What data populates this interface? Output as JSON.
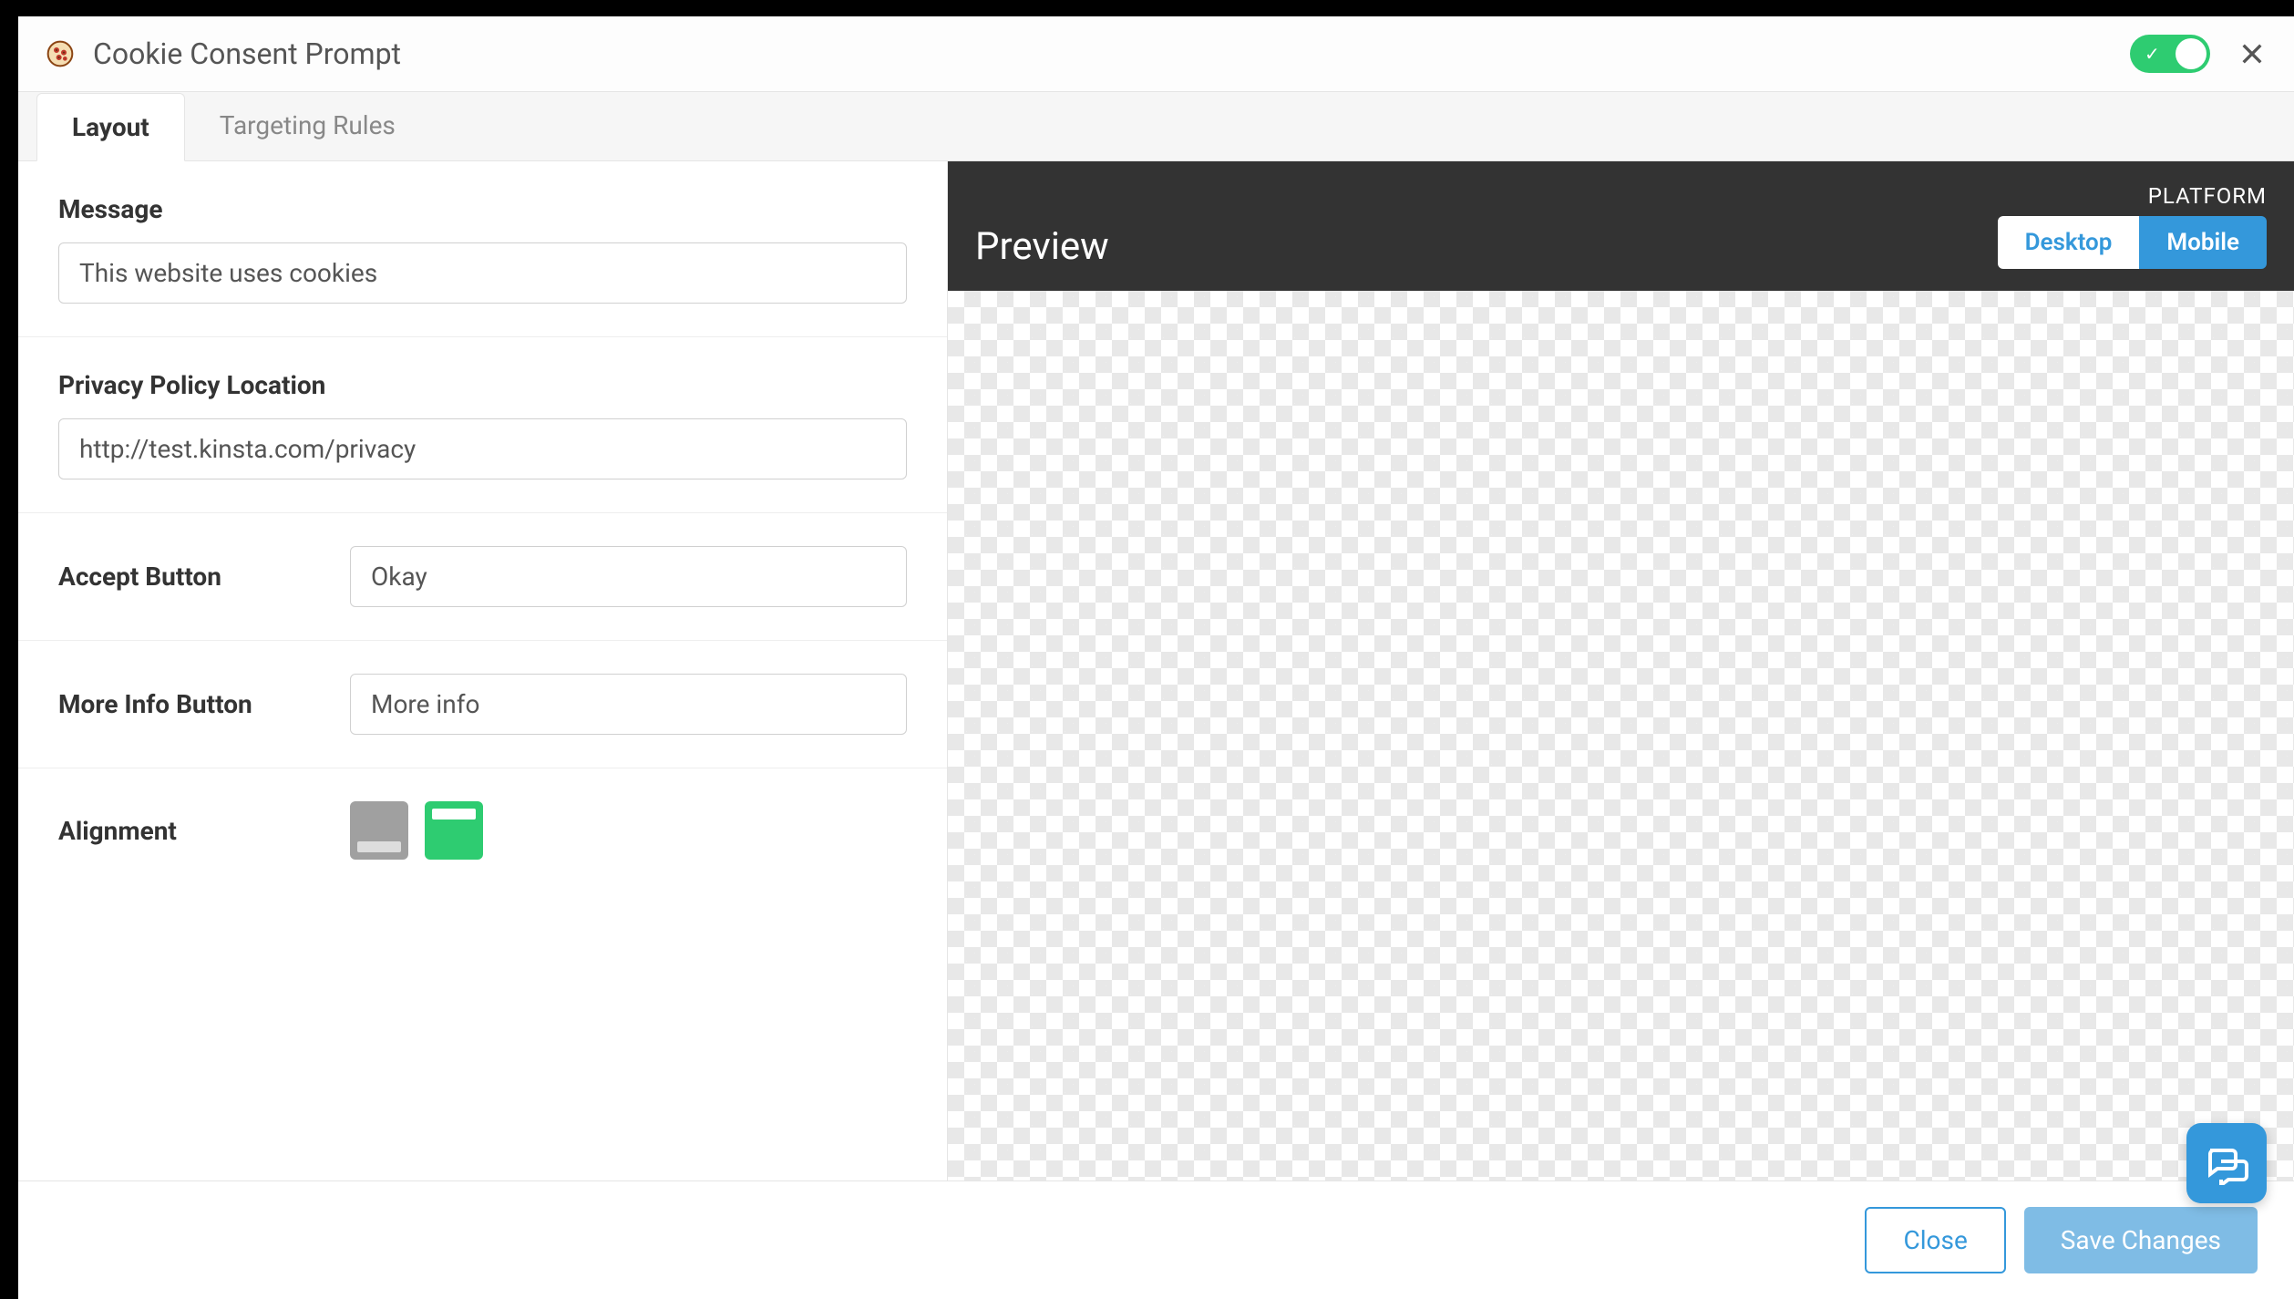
{
  "header": {
    "title": "Cookie Consent Prompt",
    "toggleEnabled": true
  },
  "tabs": [
    {
      "label": "Layout",
      "active": true
    },
    {
      "label": "Targeting Rules",
      "active": false
    }
  ],
  "form": {
    "messageLabel": "Message",
    "messageValue": "This website uses cookies",
    "privacyLabel": "Privacy Policy Location",
    "privacyValue": "http://test.kinsta.com/privacy",
    "acceptLabel": "Accept Button",
    "acceptValue": "Okay",
    "moreInfoLabel": "More Info Button",
    "moreInfoValue": "More info",
    "alignmentLabel": "Alignment"
  },
  "preview": {
    "title": "Preview",
    "platformLabel": "PLATFORM",
    "desktopBtn": "Desktop",
    "mobileBtn": "Mobile"
  },
  "footer": {
    "closeBtn": "Close",
    "saveBtn": "Save Changes"
  }
}
